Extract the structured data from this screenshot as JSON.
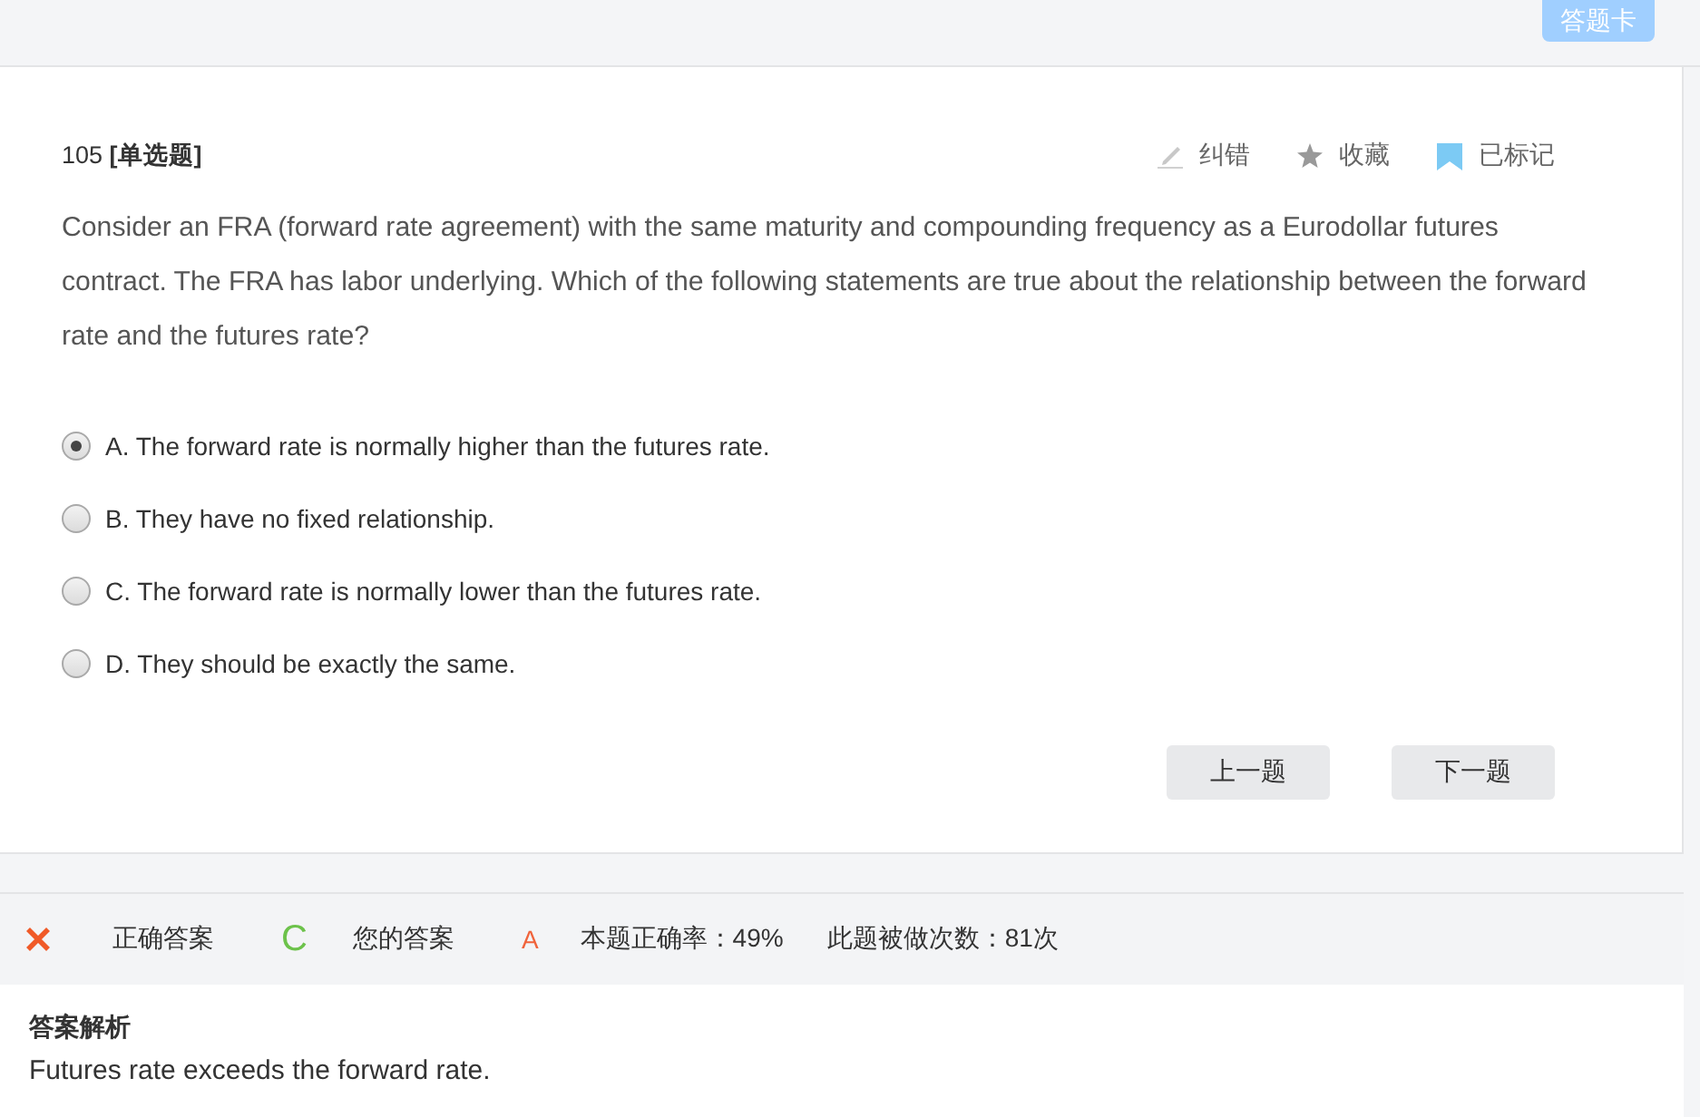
{
  "header": {
    "answer_card_button": "答题卡"
  },
  "question": {
    "number_label": "105 **[单选题]**",
    "actions": [
      {
        "kind": "report",
        "label": "纠错"
      },
      {
        "kind": "favorite",
        "label": "收藏",
        "on": false
      },
      {
        "kind": "bookmark",
        "label": "已标记",
        "on": true
      }
    ],
    "text": "Consider an FRA (forward rate agreement) with the same maturity and compounding frequency as a Eurodollar futures contract. The FRA has labor underlying. Which of the following statements are true about the relationship between the forward rate and the futures rate?",
    "options": [
      {
        "label": "A. The forward rate is normally higher than the futures rate.",
        "selected": true
      },
      {
        "label": "B. They have no fixed relationship.",
        "selected": false
      },
      {
        "label": "C. The forward rate is normally lower than the futures rate.",
        "selected": false
      },
      {
        "label": "D. They should be exactly the same.",
        "selected": false
      }
    ],
    "nav_buttons": [
      "上一题",
      "下一题"
    ]
  },
  "result": {
    "correct": false,
    "correct_answer_label": "正确答案",
    "correct_answer": "C",
    "your_answer_label": "您的答案",
    "your_answer": "A",
    "accuracy": "本题正确率：49%",
    "attempts": "此题被做次数：81次"
  },
  "analysis": {
    "title": "答案解析",
    "text": "Futures rate exceeds the forward rate."
  }
}
